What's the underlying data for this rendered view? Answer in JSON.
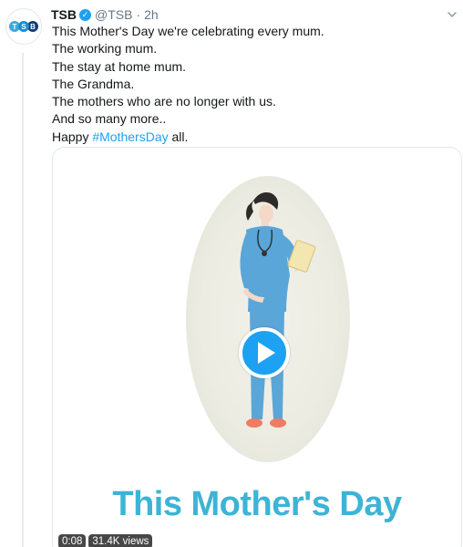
{
  "tweet": {
    "author_name": "TSB",
    "handle": "@TSB",
    "separator": "·",
    "time": "2h",
    "avatar_letters": [
      "T",
      "S",
      "B"
    ],
    "lines": [
      "This Mother's Day we're celebrating every mum.",
      "The working mum.",
      "The stay at home mum.",
      "The Grandma.",
      "The mothers who are no longer with us.",
      "And so many more..",
      "Happy "
    ],
    "hashtag": "#MothersDay",
    "after_hashtag": " all."
  },
  "media": {
    "caption": "This Mother's Day",
    "duration": "0:08",
    "views": "31.4K views"
  },
  "colors": {
    "accent": "#1da1f2",
    "caption": "#3cb4d6",
    "nurse_uniform": "#5aa6d8",
    "shoes": "#f07a62"
  },
  "icons": {
    "verified": "verified-badge-icon",
    "more": "chevron-down-icon",
    "play": "play-icon"
  }
}
